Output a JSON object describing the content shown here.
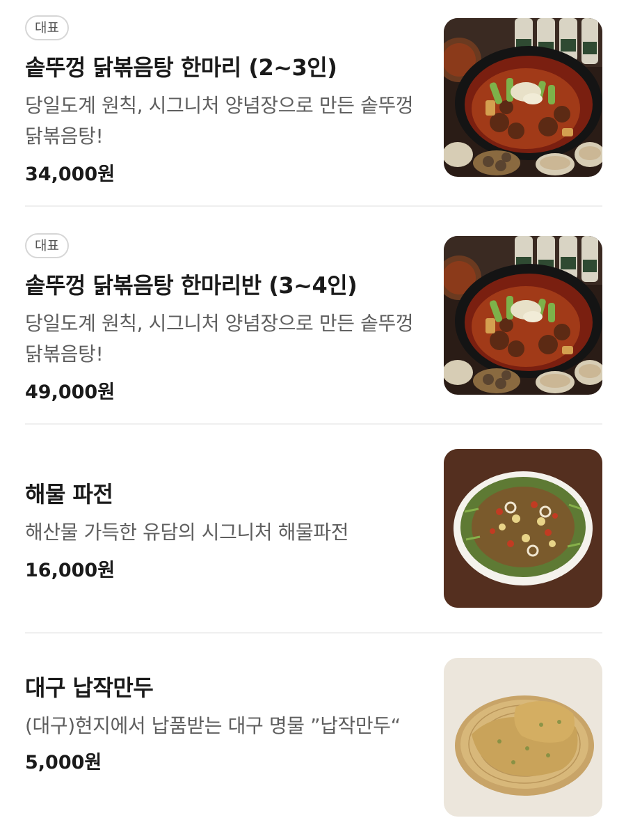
{
  "menu": {
    "items": [
      {
        "badge": "대표",
        "name": "솥뚜껑 닭볶음탕 한마리 (2~3인)",
        "description": "당일도계 원칙, 시그니처 양념장으로 만든 솥뚜껑 닭볶음탕!",
        "price": "34,000원",
        "image_icon": "braised-chicken-photo"
      },
      {
        "badge": "대표",
        "name": "솥뚜껑 닭볶음탕 한마리반 (3~4인)",
        "description": "당일도계 원칙, 시그니처 양념장으로 만든 솥뚜껑 닭볶음탕!",
        "price": "49,000원",
        "image_icon": "braised-chicken-photo"
      },
      {
        "name": "해물 파전",
        "description": "해산물 가득한 유담의 시그니처 해물파전",
        "price": "16,000원",
        "image_icon": "seafood-pancake-photo"
      },
      {
        "name": "대구 납작만두",
        "description": "(대구)현지에서 납품받는 대구 명물 ”납작만두“",
        "price": "5,000원",
        "image_icon": "flat-dumpling-photo"
      }
    ]
  }
}
